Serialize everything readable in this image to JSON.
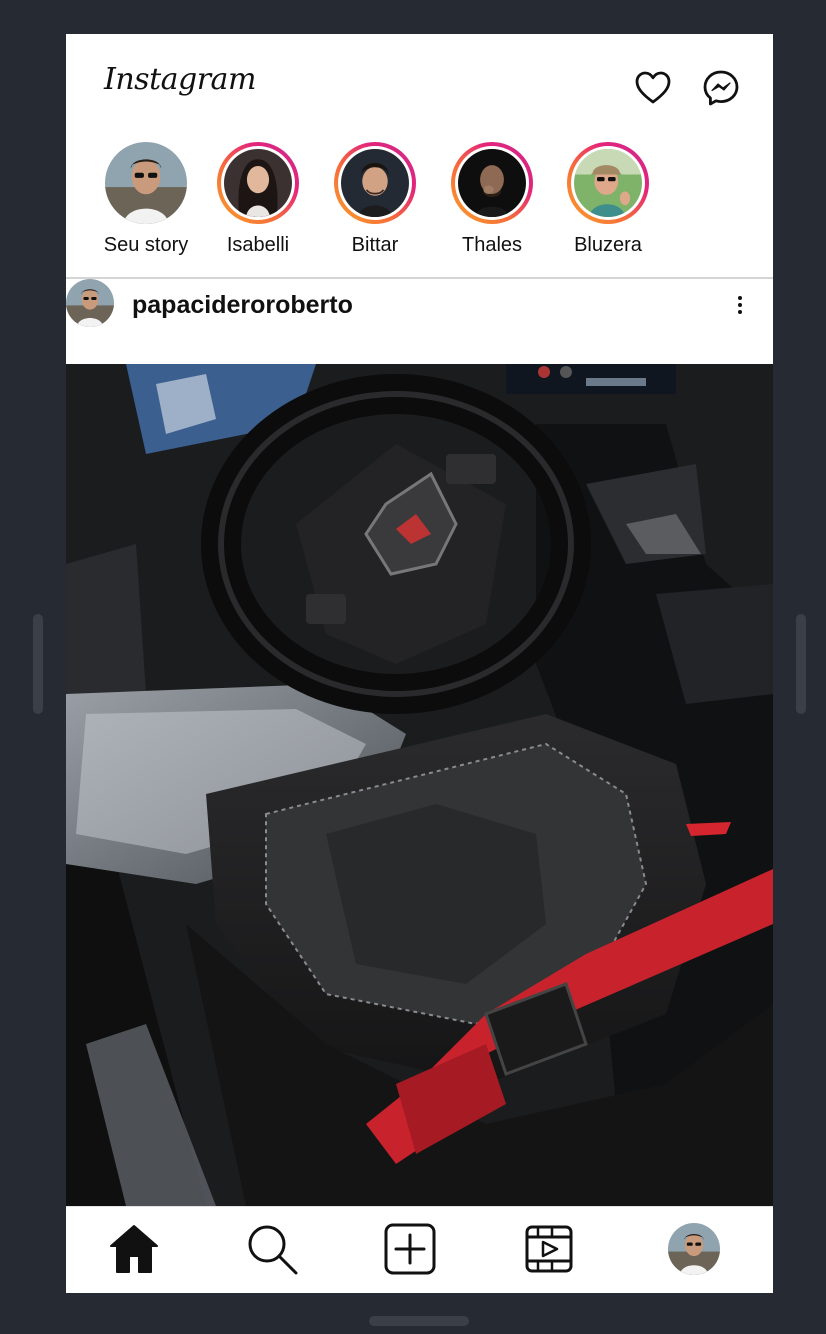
{
  "app": {
    "name": "Instagram"
  },
  "header": {
    "logo_text": "Instagram",
    "icons": [
      "heart-icon",
      "messenger-icon"
    ]
  },
  "stories": [
    {
      "name": "Seu story",
      "has_ring": false
    },
    {
      "name": "Isabelli",
      "has_ring": true
    },
    {
      "name": "Bittar",
      "has_ring": true
    },
    {
      "name": "Thales",
      "has_ring": true
    },
    {
      "name": "Bluzera",
      "has_ring": true
    }
  ],
  "post": {
    "username": "papacideroroberto",
    "image_description": "car-interior-photo"
  },
  "tabbar": {
    "items": [
      "home-icon",
      "search-icon",
      "create-icon",
      "reels-icon",
      "profile-avatar"
    ]
  },
  "colors": {
    "background": "#262b33",
    "story_ring_start": "#f9a12a",
    "story_ring_end": "#cc2d8d",
    "seatbelt": "#c8232c"
  }
}
